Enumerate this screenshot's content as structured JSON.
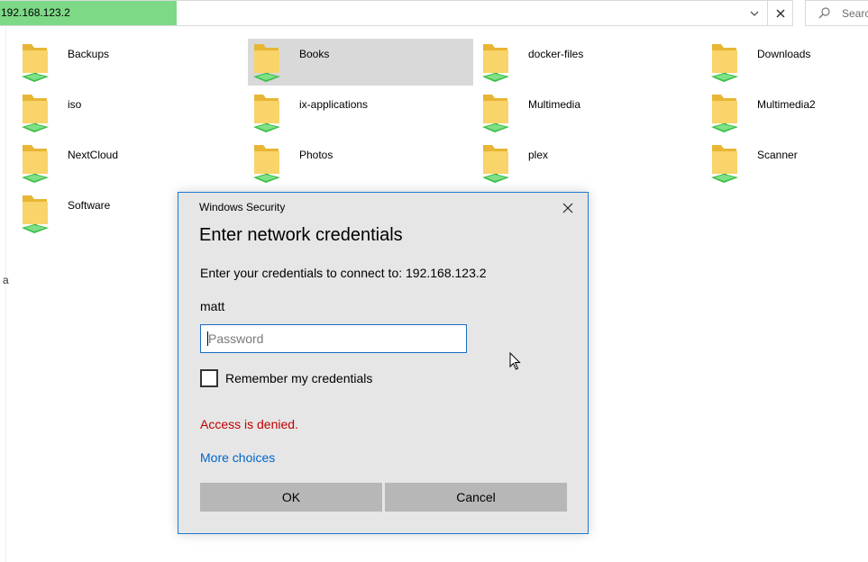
{
  "address_bar": {
    "path": "192.168.123.2",
    "progress_percent": 20
  },
  "search": {
    "placeholder": "Search"
  },
  "left_edge_char": "a",
  "folders": [
    {
      "name": "Backups"
    },
    {
      "name": "Books",
      "selected": true
    },
    {
      "name": "docker-files"
    },
    {
      "name": "Downloads"
    },
    {
      "name": "iso"
    },
    {
      "name": "ix-applications"
    },
    {
      "name": "Multimedia"
    },
    {
      "name": "Multimedia2"
    },
    {
      "name": "NextCloud"
    },
    {
      "name": "Photos"
    },
    {
      "name": "plex"
    },
    {
      "name": "Scanner"
    },
    {
      "name": "Software"
    }
  ],
  "dialog": {
    "title": "Windows Security",
    "heading": "Enter network credentials",
    "prompt": "Enter your credentials to connect to: 192.168.123.2",
    "username": "matt",
    "password_placeholder": "Password",
    "password_value": "",
    "remember_label": "Remember my credentials",
    "remember_checked": false,
    "error": "Access is denied.",
    "more_choices": "More choices",
    "ok_label": "OK",
    "cancel_label": "Cancel"
  },
  "colors": {
    "progress": "#7ed987",
    "dialog_border": "#1f7ad1",
    "error": "#c00000",
    "link": "#0066cc",
    "folder_yellow": "#f5c644",
    "network_green": "#2fb33a"
  }
}
